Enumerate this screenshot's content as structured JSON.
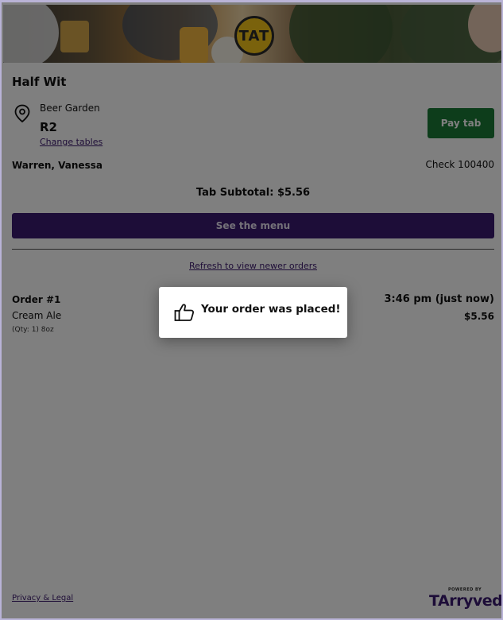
{
  "header": {
    "hero_logo_text": "TAT"
  },
  "venue": {
    "name": "Half Wit",
    "area": "Beer Garden",
    "table": "R2",
    "change_tables_label": "Change tables",
    "pay_tab_label": "Pay tab"
  },
  "tab": {
    "guest_name": "Warren, Vanessa",
    "check_label": "Check 100400",
    "subtotal_label": "Tab Subtotal: $5.56",
    "menu_button_label": "See the menu",
    "refresh_label": "Refresh to view newer orders"
  },
  "orders": [
    {
      "label": "Order #1",
      "item": "Cream Ale",
      "qty_text": "(Qty: 1) 8oz",
      "time": "3:46 pm (just now)",
      "price": "$5.56"
    }
  ],
  "footer": {
    "privacy_label": "Privacy & Legal",
    "brand_powered": "POWERED BY",
    "brand_name": "Arryved"
  },
  "toast": {
    "icon": "thumbs-up-icon",
    "message": "Your order was placed!"
  },
  "colors": {
    "pay_button": "#1a7a36",
    "menu_button": "#3a1a70",
    "link": "#3d1a6e",
    "overlay": "rgba(0,0,0,0.5)"
  }
}
